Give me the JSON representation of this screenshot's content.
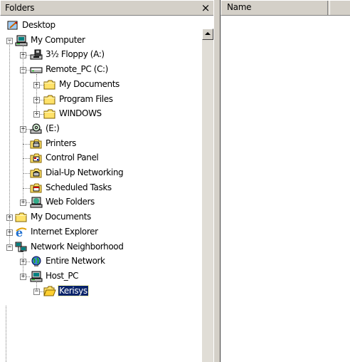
{
  "folders_pane": {
    "title": "Folders",
    "close_label": "×"
  },
  "right_pane": {
    "columns": [
      "Name",
      ""
    ]
  },
  "tree": [
    {
      "label": "Desktop",
      "icon": "desktop-icon",
      "level": 0,
      "expander": "none"
    },
    {
      "label": "My Computer",
      "icon": "computer-icon",
      "level": 0,
      "expander": "minus"
    },
    {
      "label": "3½ Floppy (A:)",
      "icon": "floppy-drive-icon",
      "level": 1,
      "expander": "plus"
    },
    {
      "label": "Remote_PC (C:)",
      "icon": "hard-drive-icon",
      "level": 1,
      "expander": "minus"
    },
    {
      "label": "My Documents",
      "icon": "folder-icon",
      "level": 2,
      "expander": "plus"
    },
    {
      "label": "Program Files",
      "icon": "folder-icon",
      "level": 2,
      "expander": "plus"
    },
    {
      "label": "WINDOWS",
      "icon": "folder-icon",
      "level": 2,
      "expander": "plus"
    },
    {
      "label": "(E:)",
      "icon": "cd-drive-icon",
      "level": 1,
      "expander": "plus"
    },
    {
      "label": "Printers",
      "icon": "printers-folder-icon",
      "level": 1,
      "expander": "none"
    },
    {
      "label": "Control Panel",
      "icon": "control-panel-icon",
      "level": 1,
      "expander": "none"
    },
    {
      "label": "Dial-Up Networking",
      "icon": "dialup-networking-icon",
      "level": 1,
      "expander": "none"
    },
    {
      "label": "Scheduled Tasks",
      "icon": "scheduled-tasks-icon",
      "level": 1,
      "expander": "none"
    },
    {
      "label": "Web Folders",
      "icon": "web-folders-icon",
      "level": 1,
      "expander": "plus"
    },
    {
      "label": "My Documents",
      "icon": "folder-icon",
      "level": 0,
      "expander": "plus"
    },
    {
      "label": "Internet Explorer",
      "icon": "internet-explorer-icon",
      "level": 0,
      "expander": "plus"
    },
    {
      "label": "Network Neighborhood",
      "icon": "network-neighborhood-icon",
      "level": 0,
      "expander": "minus"
    },
    {
      "label": "Entire Network",
      "icon": "globe-icon",
      "level": 1,
      "expander": "plus"
    },
    {
      "label": "Host_PC",
      "icon": "computer-icon",
      "level": 1,
      "expander": "plus"
    },
    {
      "label": "Kerisys",
      "icon": "open-folder-icon",
      "level": 2,
      "expander": "minus",
      "selected": true
    }
  ],
  "colors": {
    "face": "#d4d0c8",
    "selection": "#0a246a",
    "folder_yellow": "#ffcc00"
  }
}
